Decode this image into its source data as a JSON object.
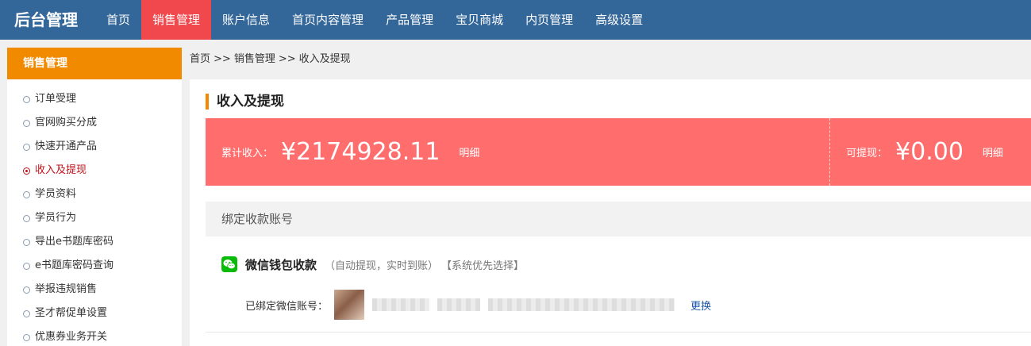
{
  "header": {
    "brand": "后台管理",
    "nav": [
      {
        "label": "首页"
      },
      {
        "label": "销售管理",
        "active": true
      },
      {
        "label": "账户信息"
      },
      {
        "label": "首页内容管理"
      },
      {
        "label": "产品管理"
      },
      {
        "label": "宝贝商城"
      },
      {
        "label": "内页管理"
      },
      {
        "label": "高级设置"
      }
    ],
    "active_color": "#f0484c",
    "bar_color": "#336699"
  },
  "sidebar": {
    "title": "销售管理",
    "items": [
      {
        "label": "订单受理"
      },
      {
        "label": "官网购买分成"
      },
      {
        "label": "快速开通产品"
      },
      {
        "label": "收入及提现",
        "active": true
      },
      {
        "label": "学员资料"
      },
      {
        "label": "学员行为"
      },
      {
        "label": "导出e书题库密码"
      },
      {
        "label": "e书题库密码查询"
      },
      {
        "label": "举报违规销售"
      },
      {
        "label": "圣才帮促单设置"
      },
      {
        "label": "优惠券业务开关"
      }
    ],
    "head_color": "#f28a00"
  },
  "breadcrumb": {
    "items": [
      "首页",
      "销售管理",
      "收入及提现"
    ],
    "separator": ">>"
  },
  "main": {
    "title": "收入及提现",
    "income": {
      "total_label": "累计收入：",
      "total_value": "¥2174928.11",
      "total_link": "明细",
      "withdrawable_label": "可提现：",
      "withdrawable_value": "¥0.00",
      "withdrawable_link": "明细",
      "card_color": "#ff6d6d"
    },
    "bind_section_title": "绑定收款账号",
    "wechat": {
      "icon": "wechat-icon",
      "title": "微信钱包收款",
      "note": "（自动提现，实时到账）",
      "priority": "【系统优先选择】",
      "bound_label": "已绑定微信账号：",
      "change_link": "更换"
    }
  }
}
